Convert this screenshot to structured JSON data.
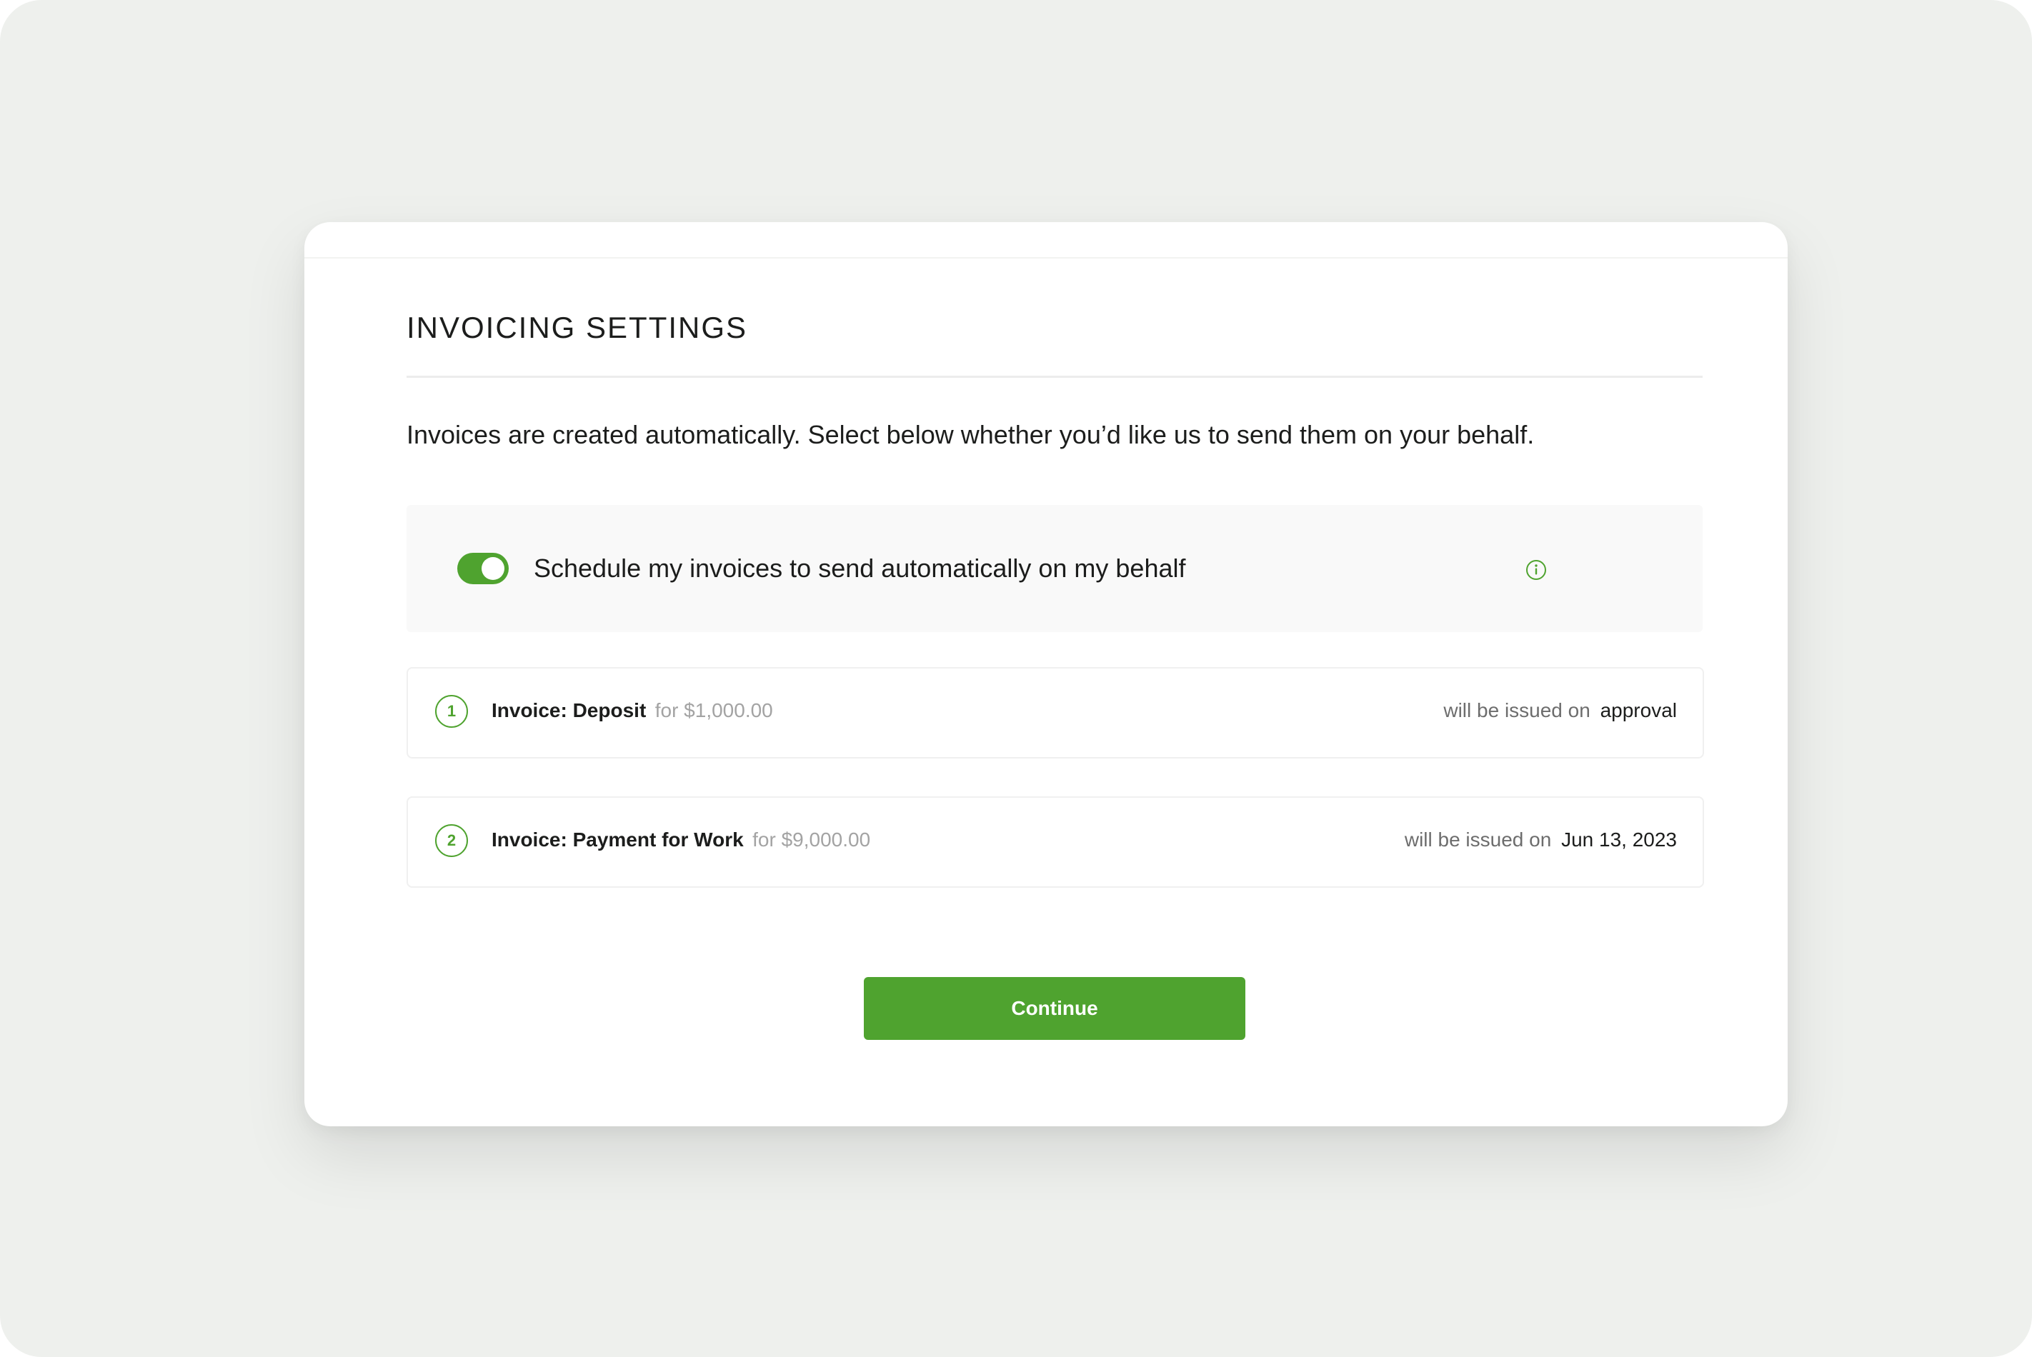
{
  "modal": {
    "title": "INVOICING SETTINGS",
    "description": "Invoices are created automatically. Select below whether you’d like us to send them on your behalf."
  },
  "schedule": {
    "enabled": true,
    "label": "Schedule my invoices to send automatically on my behalf",
    "info_icon": "info-circle-icon"
  },
  "invoices": [
    {
      "number": "1",
      "name": "Invoice: Deposit",
      "amount": "for $1,000.00",
      "issue_prefix": "will be issued on",
      "issue_when": "approval"
    },
    {
      "number": "2",
      "name": "Invoice: Payment for Work",
      "amount": "for $9,000.00",
      "issue_prefix": "will be issued on",
      "issue_when": "Jun 13, 2023"
    }
  ],
  "actions": {
    "continue_label": "Continue"
  },
  "colors": {
    "accent": "#4fa32f",
    "background": "#eef0ed",
    "panel": "#f9f9f9",
    "text": "#1c1d1c",
    "muted": "#a3a3a3"
  }
}
